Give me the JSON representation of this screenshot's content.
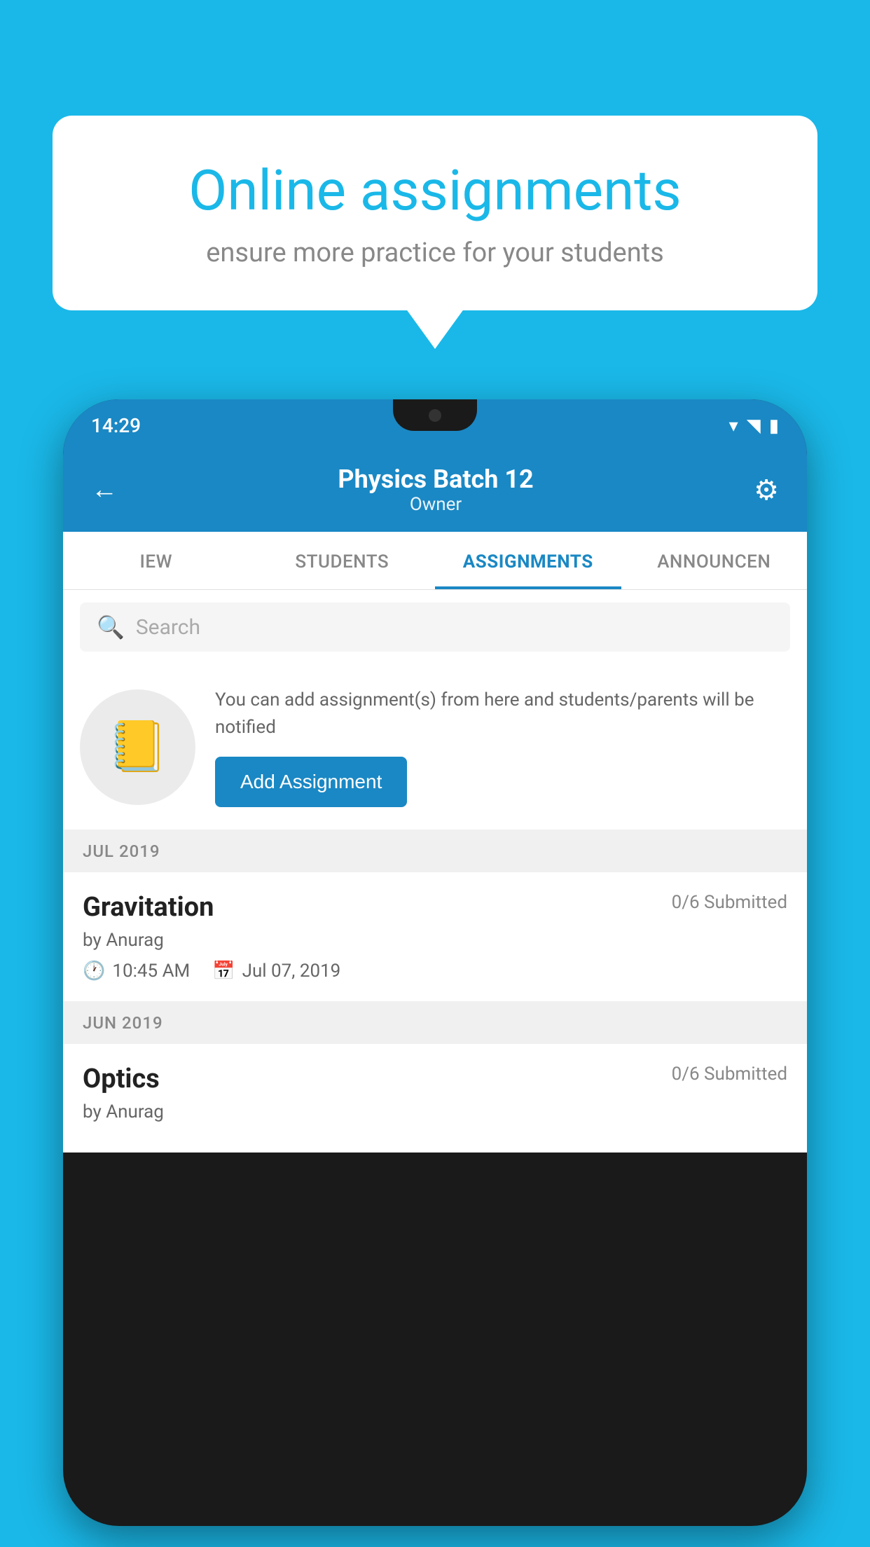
{
  "background_color": "#1ab8e8",
  "speech_bubble": {
    "title": "Online assignments",
    "subtitle": "ensure more practice for your students"
  },
  "phone": {
    "status_bar": {
      "time": "14:29",
      "icons": [
        "wifi",
        "signal",
        "battery"
      ]
    },
    "header": {
      "title": "Physics Batch 12",
      "subtitle": "Owner",
      "back_label": "←",
      "settings_label": "⚙"
    },
    "tabs": [
      {
        "label": "IEW",
        "active": false
      },
      {
        "label": "STUDENTS",
        "active": false
      },
      {
        "label": "ASSIGNMENTS",
        "active": true
      },
      {
        "label": "ANNOUNCEN",
        "active": false
      }
    ],
    "search": {
      "placeholder": "Search"
    },
    "promo": {
      "description": "You can add assignment(s) from here and students/parents will be notified",
      "button_label": "Add Assignment"
    },
    "sections": [
      {
        "month_label": "JUL 2019",
        "assignments": [
          {
            "name": "Gravitation",
            "submitted": "0/6 Submitted",
            "author": "by Anurag",
            "time": "10:45 AM",
            "date": "Jul 07, 2019"
          }
        ]
      },
      {
        "month_label": "JUN 2019",
        "assignments": [
          {
            "name": "Optics",
            "submitted": "0/6 Submitted",
            "author": "by Anurag",
            "time": "",
            "date": ""
          }
        ]
      }
    ]
  }
}
